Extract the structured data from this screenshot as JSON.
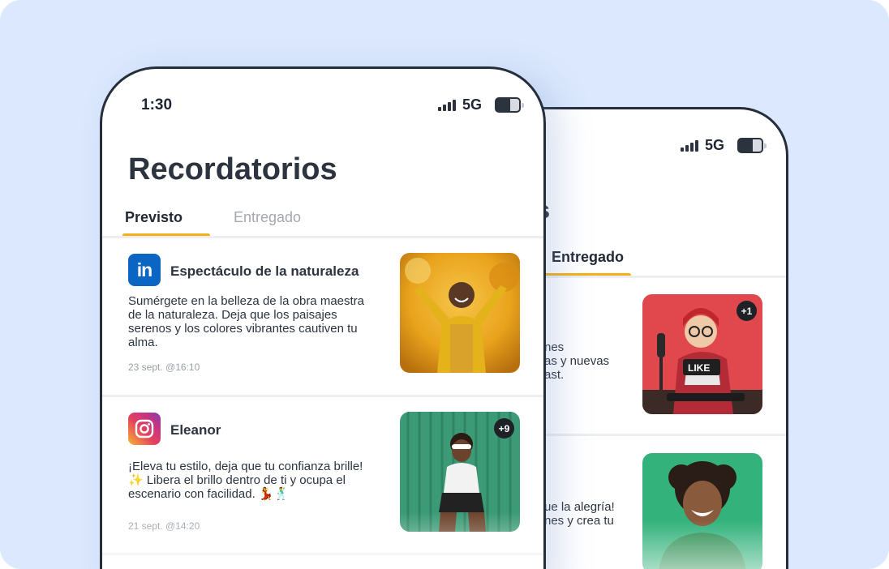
{
  "back_phone": {
    "status": {
      "network": "5G"
    },
    "title_fragment": "os",
    "tab_active": "Entregado",
    "items": [
      {
        "text_fragment": "nes\nas y nuevas\nast.",
        "badge": "+1"
      },
      {
        "text_fragment": "ue la alegría!\nnes y crea tu",
        "badge": ""
      }
    ]
  },
  "front_phone": {
    "status": {
      "time": "1:30",
      "network": "5G"
    },
    "title": "Recordatorios",
    "tabs": [
      {
        "label": "Previsto",
        "active": true
      },
      {
        "label": "Entregado",
        "active": false
      }
    ],
    "items": [
      {
        "app_icon": "linkedin-icon",
        "icon_text": "in",
        "title": "Espectáculo de la naturaleza",
        "body": "Sumérgete en la belleza de la obra maestra\nde la naturaleza. Deja que los paisajes\nserenos y los colores vibrantes cautiven tu\nalma.",
        "date": "23 sept. @16:10",
        "badge": ""
      },
      {
        "app_icon": "instagram-icon",
        "title": "Eleanor",
        "body": "¡Eleva tu estilo, deja que tu confianza brille!\n✨ Libera el brillo dentro de ti y ocupa el\nescenario con facilidad. 💃🕺",
        "date": "21 sept. @14:20",
        "badge": "+9"
      }
    ]
  },
  "colors": {
    "background": "#dbe8fd",
    "accent_underline": "#f4b016",
    "phone_frame": "#252e3b",
    "linkedin": "#0a66c2"
  }
}
